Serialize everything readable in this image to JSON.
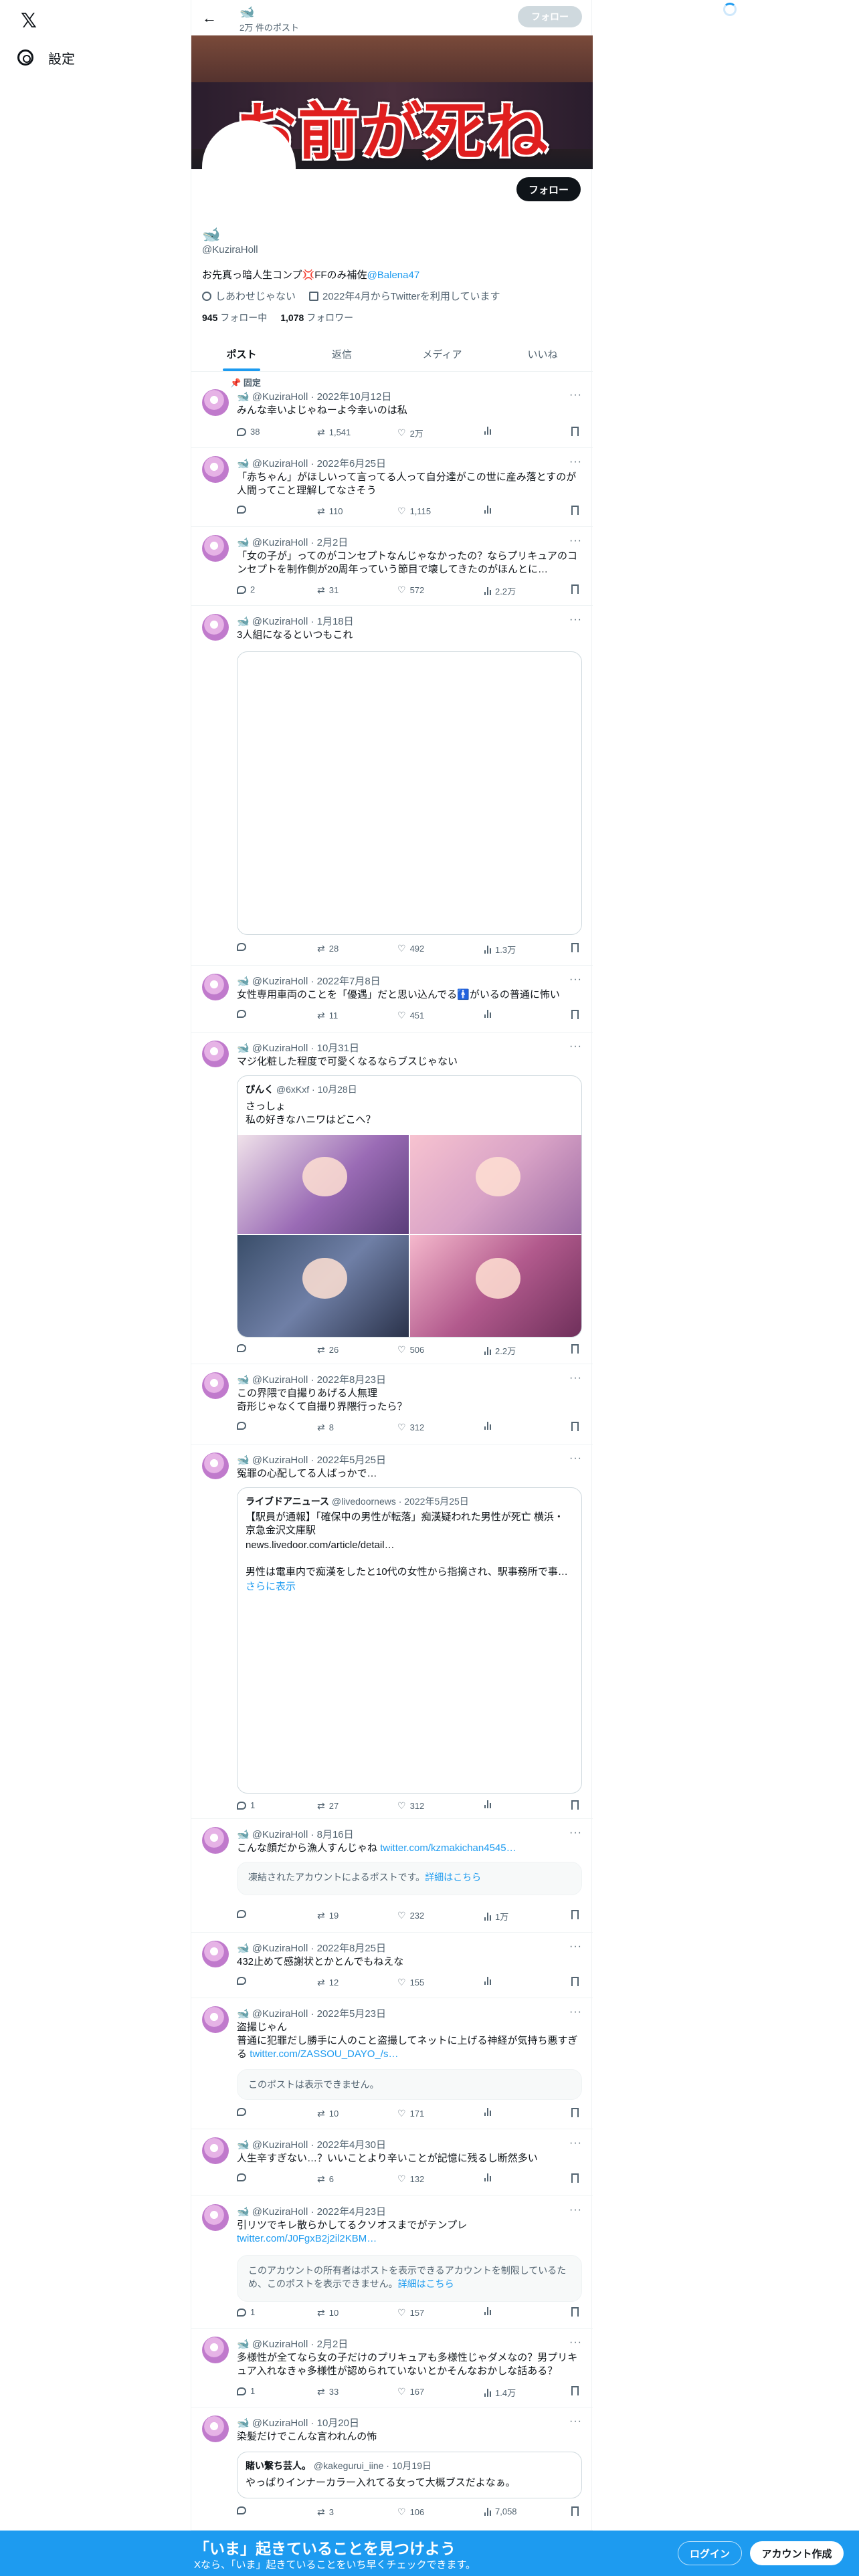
{
  "nav": {
    "settings_label": "設定"
  },
  "topbar": {
    "name": "🐋",
    "post_count": "2万 件のポスト",
    "follow_label": "フォロー"
  },
  "banner": {
    "text": "お前が死ねよ!"
  },
  "profile": {
    "name": "🐋",
    "handle": "@KuziraHoll",
    "bio_main": "お先真っ暗人生コンプ💢FFのみ補佐",
    "bio_mention": "@Balena47",
    "location": "しあわせじゃない",
    "joined": "2022年4月からTwitterを利用しています",
    "following_count": "945",
    "following_label": "フォロー中",
    "followers_count": "1,078",
    "followers_label": "フォロワー",
    "follow_label": "フォロー"
  },
  "tabs": [
    "ポスト",
    "返信",
    "メディア",
    "いいね"
  ],
  "pinned_label": "固定",
  "tweets": [
    {
      "handle": "@KuziraHoll",
      "date": "2022年10月12日",
      "text": "みんな幸いよじゃねーよ今幸いのは私",
      "reply": "38",
      "rt": "1,541",
      "like": "2万",
      "view": ""
    },
    {
      "handle": "@KuziraHoll",
      "date": "2022年6月25日",
      "text": "「赤ちゃん」がほしいって言ってる人って自分達がこの世に産み落とすのが人間ってこと理解してなさそう",
      "reply": "",
      "rt": "110",
      "like": "1,115",
      "view": ""
    },
    {
      "handle": "@KuziraHoll",
      "date": "2月2日",
      "text": "「女の子が」ってのがコンセプトなんじゃなかったの？ならプリキュアのコンセプトを制作側が20周年っていう節目で壊してきたのがほんとに…",
      "reply": "2",
      "rt": "31",
      "like": "572",
      "view": "2.2万"
    },
    {
      "handle": "@KuziraHoll",
      "date": "1月18日",
      "text": "3人組になるといつもこれ",
      "reply": "",
      "rt": "28",
      "like": "492",
      "view": "1.3万"
    },
    {
      "handle": "@KuziraHoll",
      "date": "2022年7月8日",
      "text": "女性専用車両のことを「優遇」だと思い込んでる🚹がいるの普通に怖い",
      "reply": "",
      "rt": "11",
      "like": "451",
      "view": ""
    },
    {
      "handle": "@KuziraHoll",
      "date": "10月31日",
      "text": "マジ化粧した程度で可愛くなるならブスじゃない",
      "reply": "",
      "rt": "26",
      "like": "506",
      "view": "2.2万",
      "quote": {
        "name": "ぴんく",
        "handle": "@6xKxf",
        "date": "10月28日",
        "line1": "さっしょ",
        "line2": "私の好きなハニワはどこへ？"
      }
    },
    {
      "handle": "@KuziraHoll",
      "date": "2022年8月23日",
      "text1": "この界隈で自撮りあげる人無理",
      "text2": "奇形じゃなくて自撮り界隈行ったら？",
      "reply": "",
      "rt": "8",
      "like": "312",
      "view": ""
    },
    {
      "handle": "@KuziraHoll",
      "date": "2022年5月25日",
      "text": "冤罪の心配してる人ばっかで…",
      "reply": "1",
      "rt": "27",
      "like": "312",
      "view": "",
      "quote": {
        "name": "ライブドアニュース",
        "handle": "@livedoornews",
        "date": "2022年5月25日",
        "line1": "【駅員が通報】「確保中の男性が転落」痴漢疑われた男性が死亡 横浜・京急金沢文庫駅",
        "link": "news.livedoor.com/article/detail…",
        "line2": "男性は電車内で痴漢をしたと10代の女性から指摘され、駅事務所で事…",
        "more": "さらに表示"
      }
    },
    {
      "handle": "@KuziraHoll",
      "date": "8月16日",
      "text": "こんな顔だから漁人すんじゃね",
      "link": "twitter.com/kzmakichan4545…",
      "notice": "凍結されたアカウントによるポストです。",
      "notice_link": "詳細はこちら",
      "reply": "",
      "rt": "19",
      "like": "232",
      "view": "1万"
    },
    {
      "handle": "@KuziraHoll",
      "date": "2022年8月25日",
      "text": "432止めて感謝状とかとんでもねえな",
      "reply": "",
      "rt": "12",
      "like": "155",
      "view": ""
    },
    {
      "handle": "@KuziraHoll",
      "date": "2022年5月23日",
      "text1": "盗撮じゃん",
      "text2": "普通に犯罪だし勝手に人のこと盗撮してネットに上げる神経が気持ち悪すぎる",
      "link": "twitter.com/ZASSOU_DAYO_/s…",
      "notice": "このポストは表示できません。",
      "reply": "",
      "rt": "10",
      "like": "171",
      "view": ""
    },
    {
      "handle": "@KuziraHoll",
      "date": "2022年4月30日",
      "text": "人生辛すぎない…？いいことより辛いことが記憶に残るし断然多い",
      "reply": "",
      "rt": "6",
      "like": "132",
      "view": ""
    },
    {
      "handle": "@KuziraHoll",
      "date": "2022年4月23日",
      "text": "引リツでキレ散らかしてるクソオスまでがテンプレ",
      "link": "twitter.com/J0FgxB2j2il2KBM…",
      "notice": "このアカウントの所有者はポストを表示できるアカウントを制限しているため、このポストを表示できません。",
      "notice_link": "詳細はこちら",
      "reply": "1",
      "rt": "10",
      "like": "157",
      "view": ""
    },
    {
      "handle": "@KuziraHoll",
      "date": "2月2日",
      "text": "多様性が全てなら女の子だけのプリキュアも多様性じゃダメなの？男プリキュア入れなきゃ多様性が認められていないとかそんなおかしな話ある？",
      "reply": "1",
      "rt": "33",
      "like": "167",
      "view": "1.4万"
    },
    {
      "handle": "@KuziraHoll",
      "date": "10月20日",
      "text": "染髪だけでこんな言われんの怖",
      "reply": "",
      "rt": "3",
      "like": "106",
      "view": "7,058",
      "quote": {
        "name": "賭い繋ち芸人。",
        "handle": "@kakegurui_iine",
        "date": "10月19日",
        "line1": "やっぱりインナーカラー入れてる女って大概ブスだよなぁ。"
      }
    }
  ],
  "bottom": {
    "title": "「いま」起きていることを見つけよう",
    "subtitle": "Xなら、「いま」起きていることをいち早くチェックできます。",
    "login": "ログイン",
    "signup": "アカウント作成"
  }
}
